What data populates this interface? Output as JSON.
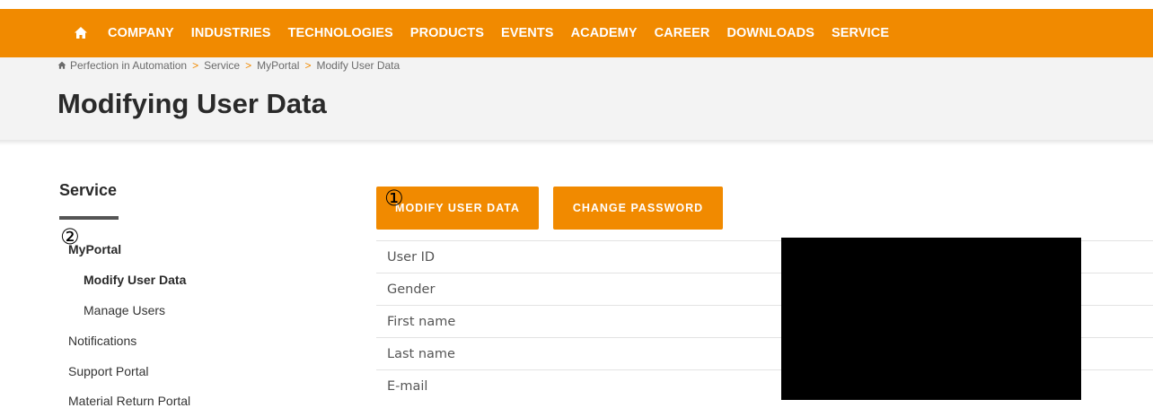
{
  "nav": {
    "items": [
      "COMPANY",
      "INDUSTRIES",
      "TECHNOLOGIES",
      "PRODUCTS",
      "EVENTS",
      "ACADEMY",
      "CAREER",
      "DOWNLOADS",
      "SERVICE"
    ],
    "home_icon": "home-icon"
  },
  "breadcrumb": {
    "items": [
      "Perfection in Automation",
      "Service",
      "MyPortal",
      "Modify User Data"
    ],
    "separator": ">"
  },
  "page": {
    "title": "Modifying User Data"
  },
  "sidebar": {
    "title": "Service",
    "items": [
      {
        "label": "MyPortal"
      },
      {
        "label": "Modify User Data"
      },
      {
        "label": "Manage Users"
      },
      {
        "label": "Notifications"
      },
      {
        "label": "Support Portal"
      },
      {
        "label": "Material Return Portal"
      }
    ]
  },
  "markers": {
    "one": "①",
    "two": "②"
  },
  "buttons": {
    "modify": "MODIFY USER DATA",
    "change_password": "CHANGE PASSWORD"
  },
  "fields": [
    {
      "label": "User ID"
    },
    {
      "label": "Gender"
    },
    {
      "label": "First name"
    },
    {
      "label": "Last name"
    },
    {
      "label": "E-mail"
    }
  ],
  "colors": {
    "accent": "#f18a00",
    "redaction": "#000000"
  }
}
